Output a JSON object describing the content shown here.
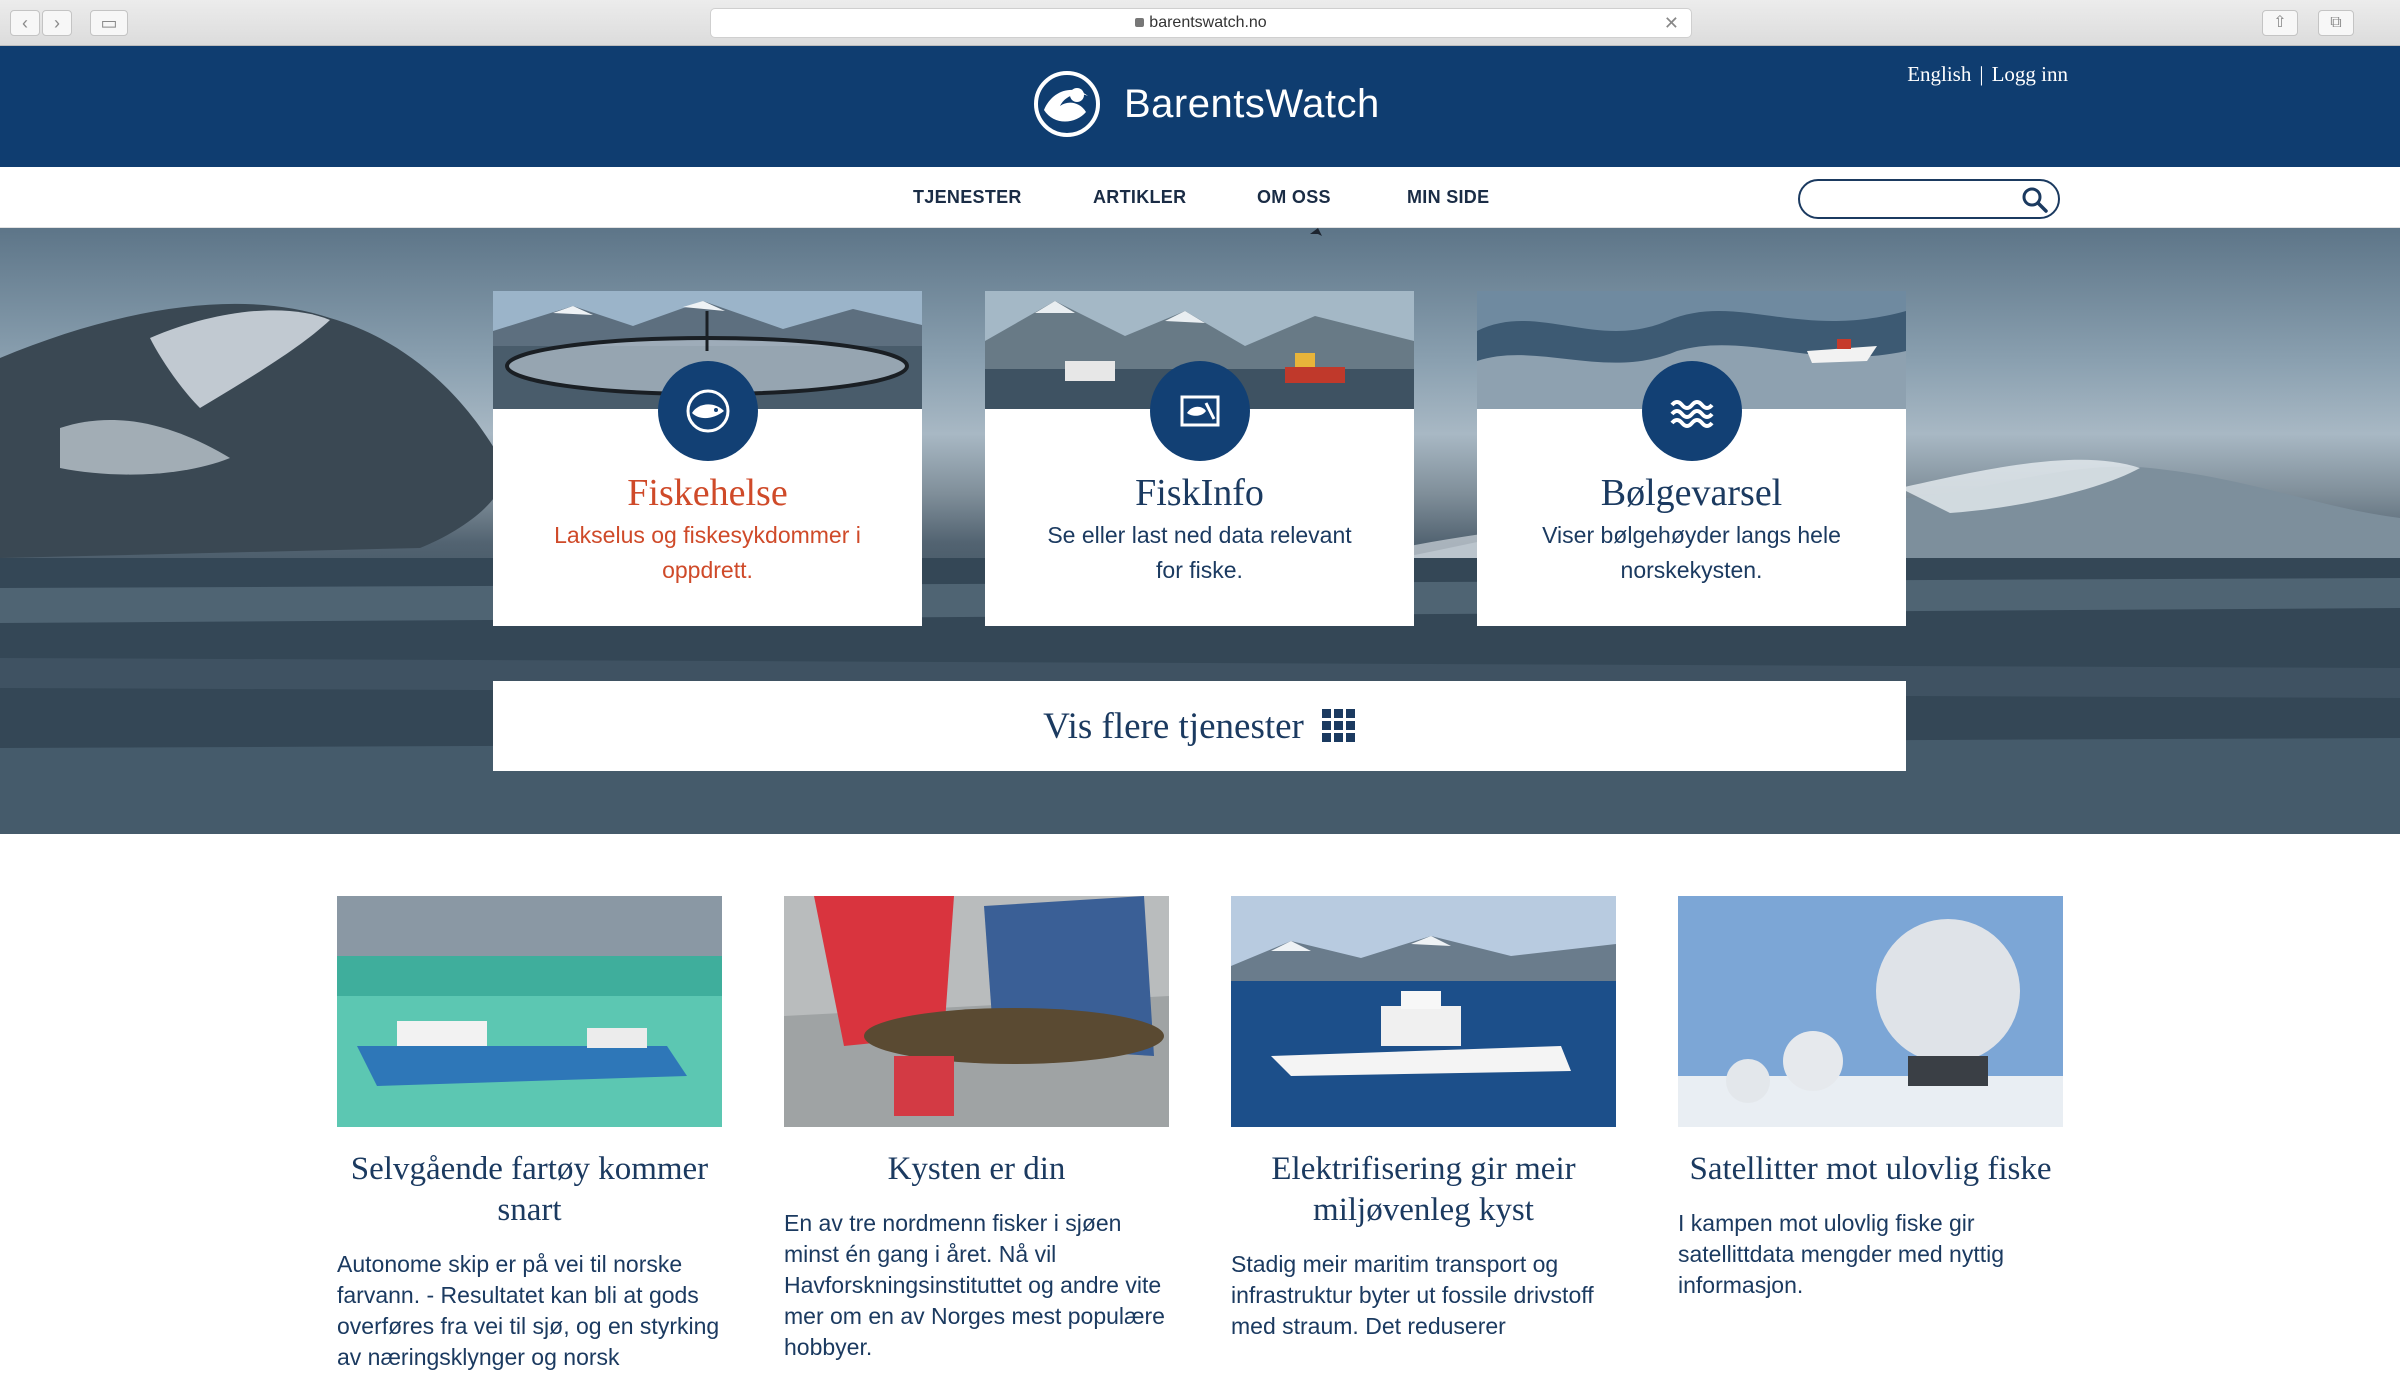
{
  "browser": {
    "url": "barentswatch.no",
    "back_glyph": "‹",
    "forward_glyph": "›",
    "sidebar_glyph": "▭",
    "close_glyph": "✕",
    "share_glyph": "⇧",
    "tabs_glyph": "⧉"
  },
  "header": {
    "brand": "BarentsWatch",
    "lang_link": "English",
    "separator": "|",
    "login_link": "Logg inn"
  },
  "nav": {
    "items": [
      "TJENESTER",
      "ARTIKLER",
      "OM OSS",
      "MIN SIDE"
    ],
    "search_placeholder": ""
  },
  "services": [
    {
      "title": "Fiskehelse",
      "desc": "Lakselus og fiskesykdommer i oppdrett.",
      "icon": "fish-globe-icon",
      "color": "#cf4a29"
    },
    {
      "title": "FiskInfo",
      "desc": "Se eller last ned data relevant for fiske.",
      "icon": "fish-map-icon",
      "color": "#1b3a60"
    },
    {
      "title": "Bølgevarsel",
      "desc": "Viser bølgehøyder langs hele norskekysten.",
      "icon": "waves-icon",
      "color": "#1b3a60"
    }
  ],
  "more_services": {
    "label": "Vis flere tjenester",
    "icon": "grid-icon"
  },
  "articles": [
    {
      "title": "Selvgående fartøy kommer snart",
      "desc": "Autonome skip er på vei til norske farvann. -  Resultatet kan bli at gods overføres fra vei til sjø, og en styrking av næringsklynger og norsk"
    },
    {
      "title": "Kysten er din",
      "desc": "En av tre nordmenn fisker i sjøen minst én gang i året. Nå vil Havforskningsinstituttet og andre vite mer om en av Norges mest populære hobbyer."
    },
    {
      "title": "Elektrifisering gir meir miljøvenleg kyst",
      "desc": "Stadig meir maritim transport og infrastruktur byter ut fossile drivstoff med straum. Det reduserer"
    },
    {
      "title": "Satellitter mot ulovlig fiske",
      "desc": "I kampen mot ulovlig fiske gir satellittdata mengder med nyttig informasjon."
    }
  ],
  "colors": {
    "brand_navy": "#0f3d70",
    "text_navy": "#1b3a60",
    "accent_red": "#cf4a29"
  }
}
